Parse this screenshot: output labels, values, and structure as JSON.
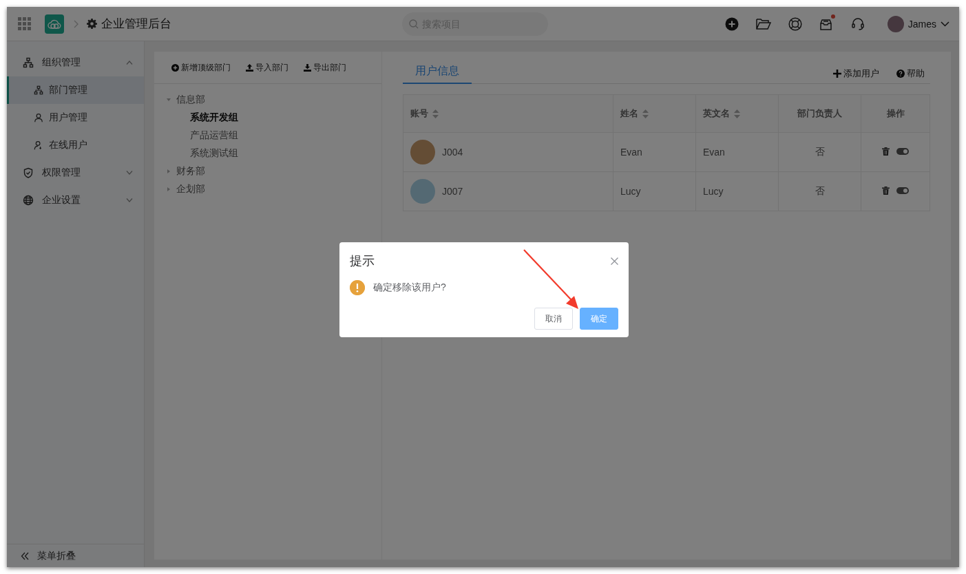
{
  "topbar": {
    "title": "企业管理后台",
    "search": {
      "placeholder": "搜索项目"
    },
    "icons": [
      {
        "kind": "add"
      },
      {
        "kind": "folder"
      },
      {
        "kind": "lifebuoy"
      },
      {
        "kind": "inbox",
        "unread": true
      },
      {
        "kind": "headset"
      }
    ],
    "user": {
      "name": "James"
    }
  },
  "sidebar": {
    "items": [
      {
        "label": "组织管理",
        "kind": "org",
        "expanded": true,
        "children": [
          {
            "label": "部门管理",
            "kind": "org",
            "selected": true
          },
          {
            "label": "用户管理",
            "kind": "user",
            "selected": false
          },
          {
            "label": "在线用户",
            "kind": "online",
            "selected": false
          }
        ]
      },
      {
        "label": "权限管理",
        "kind": "shield",
        "expanded": false
      },
      {
        "label": "企业设置",
        "kind": "globe",
        "expanded": false
      }
    ],
    "collapse": {
      "label": "菜单折叠"
    }
  },
  "dept_panel": {
    "toolbar": [
      {
        "label": "新增顶级部门",
        "kind": "add"
      },
      {
        "label": "导入部门",
        "kind": "import"
      },
      {
        "label": "导出部门",
        "kind": "export"
      }
    ],
    "tree": [
      {
        "label": "信息部",
        "expanded": true,
        "selected": false,
        "children": [
          {
            "label": "系统开发组",
            "selected": true
          },
          {
            "label": "产品运营组",
            "selected": false
          },
          {
            "label": "系统测试组",
            "selected": false
          }
        ]
      },
      {
        "label": "财务部",
        "expanded": false,
        "selected": false
      },
      {
        "label": "企划部",
        "expanded": false,
        "selected": false
      }
    ]
  },
  "user_panel": {
    "tabs": [
      {
        "label": "用户信息",
        "selected": true
      }
    ],
    "actions": [
      {
        "label": "添加用户",
        "kind": "add"
      },
      {
        "label": "帮助",
        "kind": "help"
      }
    ],
    "table": {
      "columns": [
        {
          "label": "账号",
          "sortable": true
        },
        {
          "label": "姓名",
          "sortable": true
        },
        {
          "label": "英文名",
          "sortable": true
        },
        {
          "label": "部门负责人",
          "sortable": false
        },
        {
          "label": "操作",
          "sortable": false
        }
      ],
      "rows": [
        {
          "account": "J004",
          "name": "Evan",
          "english_name": "Evan",
          "is_manager": "否",
          "on": true
        },
        {
          "account": "J007",
          "name": "Lucy",
          "english_name": "Lucy",
          "is_manager": "否",
          "on": true
        }
      ]
    }
  },
  "dialog": {
    "title": "提示",
    "message": "确定移除该用户?",
    "buttons": [
      {
        "label": "取消",
        "kind": "default"
      },
      {
        "label": "确定",
        "kind": "primary"
      }
    ]
  }
}
